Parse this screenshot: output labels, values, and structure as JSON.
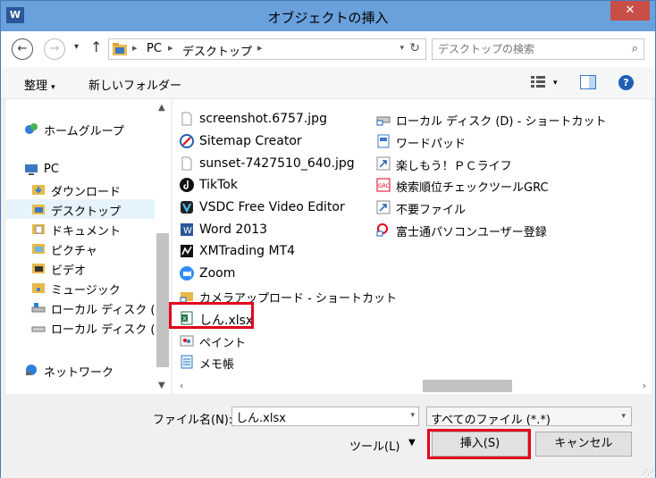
{
  "window": {
    "title": "オブジェクトの挿入",
    "app_icon": "W",
    "close_label": "✕"
  },
  "address": {
    "crumbs": [
      "PC",
      "デスクトップ"
    ],
    "search_placeholder": "デスクトップの検索"
  },
  "toolbar": {
    "organize_label": "整理",
    "new_folder_label": "新しいフォルダー",
    "help_label": "?"
  },
  "nav": {
    "homegroup": "ホームグループ",
    "pc": "PC",
    "items": [
      "ダウンロード",
      "デスクトップ",
      "ドキュメント",
      "ピクチャ",
      "ビデオ",
      "ミュージック",
      "ローカル ディスク (C:",
      "ローカル ディスク (D:"
    ],
    "network": "ネットワーク",
    "selected": "デスクトップ"
  },
  "files": {
    "col1": [
      {
        "name": "screenshot.6757.jpg",
        "icon": "image-file-icon"
      },
      {
        "name": "Sitemap Creator",
        "icon": "sitemap-creator-icon"
      },
      {
        "name": "sunset-7427510_640.jpg",
        "icon": "image-file-icon"
      },
      {
        "name": "TikTok",
        "icon": "tiktok-icon"
      },
      {
        "name": "VSDC Free Video Editor",
        "icon": "vsdc-icon"
      },
      {
        "name": "Word 2013",
        "icon": "word-icon"
      },
      {
        "name": "XMTrading MT4",
        "icon": "mt4-icon"
      },
      {
        "name": "Zoom",
        "icon": "zoom-icon"
      },
      {
        "name": "カメラアップロード - ショートカット",
        "icon": "shortcut-folder-icon"
      },
      {
        "name": "しん.xlsx",
        "icon": "excel-file-icon",
        "highlighted": true
      },
      {
        "name": "ペイント",
        "icon": "paint-icon"
      },
      {
        "name": "メモ帳",
        "icon": "notepad-icon"
      }
    ],
    "col2": [
      {
        "name": "ローカル ディスク (D) - ショートカット",
        "icon": "drive-shortcut-icon"
      },
      {
        "name": "ワードパッド",
        "icon": "wordpad-icon"
      },
      {
        "name": "楽しもう！ＰＣライフ",
        "icon": "shortcut-icon"
      },
      {
        "name": "検索順位チェックツールGRC",
        "icon": "grc-icon"
      },
      {
        "name": "不要ファイル",
        "icon": "shortcut-icon"
      },
      {
        "name": "富士通パソコンユーザー登録",
        "icon": "fujitsu-icon"
      }
    ]
  },
  "bottom": {
    "filename_label": "ファイル名(N):",
    "filename_value": "しん.xlsx",
    "filter_value": "すべてのファイル (*.*)",
    "tools_label": "ツール(L)",
    "insert_label": "挿入(S)",
    "cancel_label": "キャンセル"
  },
  "colors": {
    "titlebar": "#6aa0dc",
    "close": "#c74f47",
    "highlight": "#e3001b",
    "selection": "#e5f3fb"
  }
}
